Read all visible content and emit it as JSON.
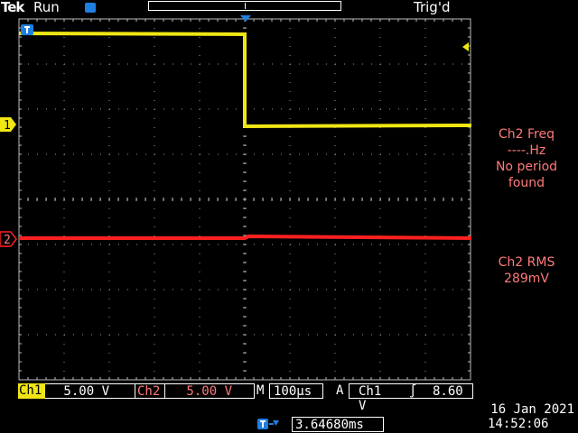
{
  "header": {
    "brand": "Tek",
    "run_state": "Run",
    "trigger_status": "Trig'd",
    "record_position": 0.5
  },
  "channels": [
    {
      "id": "1",
      "marker_label": "1",
      "color": "#f0e614"
    },
    {
      "id": "2",
      "marker_label": "2",
      "color": "#ff2020"
    }
  ],
  "measurements": {
    "freq_title": "Ch2 Freq",
    "freq_value": "----.Hz",
    "freq_note_1": "No period",
    "freq_note_2": "found",
    "rms_title": "Ch2 RMS",
    "rms_value": "289mV"
  },
  "bottom_bar": {
    "ch1_label": "Ch1",
    "ch1_scale": "5.00 V",
    "ch2_label": "Ch2",
    "ch2_scale": "5.00 V",
    "mode_label": "M",
    "timebase": "100µs",
    "trigger_mode_label": "A",
    "trigger_source": "Ch1",
    "trigger_slope_symbol": "∫",
    "trigger_level": "8.60 V",
    "horizontal_position": "3.64680ms"
  },
  "datetime": {
    "date": "16 Jan  2021",
    "time": "14:52:06"
  },
  "colors": {
    "ch1": "#f0e614",
    "ch2": "#ff2020",
    "measurement_text": "#ff7a7a",
    "marker_blue": "#1f7fe0"
  }
}
